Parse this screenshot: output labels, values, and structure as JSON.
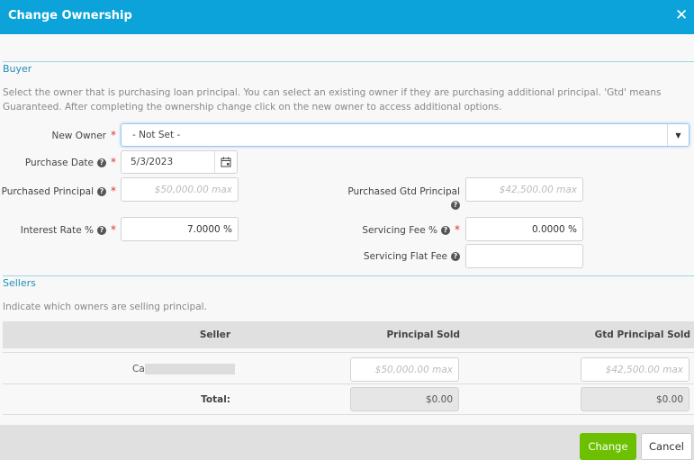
{
  "header": {
    "title": "Change Ownership",
    "close_label": "✕"
  },
  "buyer": {
    "section_title": "Buyer",
    "description": "Select the owner that is purchasing loan principal. You can select an existing owner if they are purchasing additional principal. 'Gtd' means Guaranteed. After completing the ownership change click on the new owner to access additional options.",
    "new_owner_label": "New Owner",
    "new_owner_value": "- Not Set -",
    "purchase_date_label": "Purchase Date",
    "purchase_date_value": "5/3/2023",
    "purchased_principal_label": "Purchased Principal",
    "purchased_principal_placeholder": "$50,000.00 max",
    "interest_rate_label": "Interest Rate %",
    "interest_rate_value": "7.0000 %",
    "purchased_gtd_label": "Purchased Gtd Principal",
    "purchased_gtd_placeholder": "$42,500.00 max",
    "servicing_fee_label": "Servicing Fee %",
    "servicing_fee_value": "0.0000 %",
    "servicing_flat_fee_label": "Servicing Flat Fee",
    "servicing_flat_fee_value": ""
  },
  "sellers": {
    "section_title": "Sellers",
    "description": "Indicate which owners are selling principal.",
    "columns": [
      "Seller",
      "Principal Sold",
      "Gtd Principal Sold"
    ],
    "rows": [
      {
        "seller": "Ca",
        "principal_placeholder": "$50,000.00 max",
        "gtd_placeholder": "$42,500.00 max"
      }
    ],
    "total_label": "Total:",
    "total_principal": "$0.00",
    "total_gtd": "$0.00"
  },
  "footer": {
    "change_label": "Change",
    "cancel_label": "Cancel"
  },
  "colors": {
    "header": "#0ba3d9",
    "change": "#6cc000"
  }
}
